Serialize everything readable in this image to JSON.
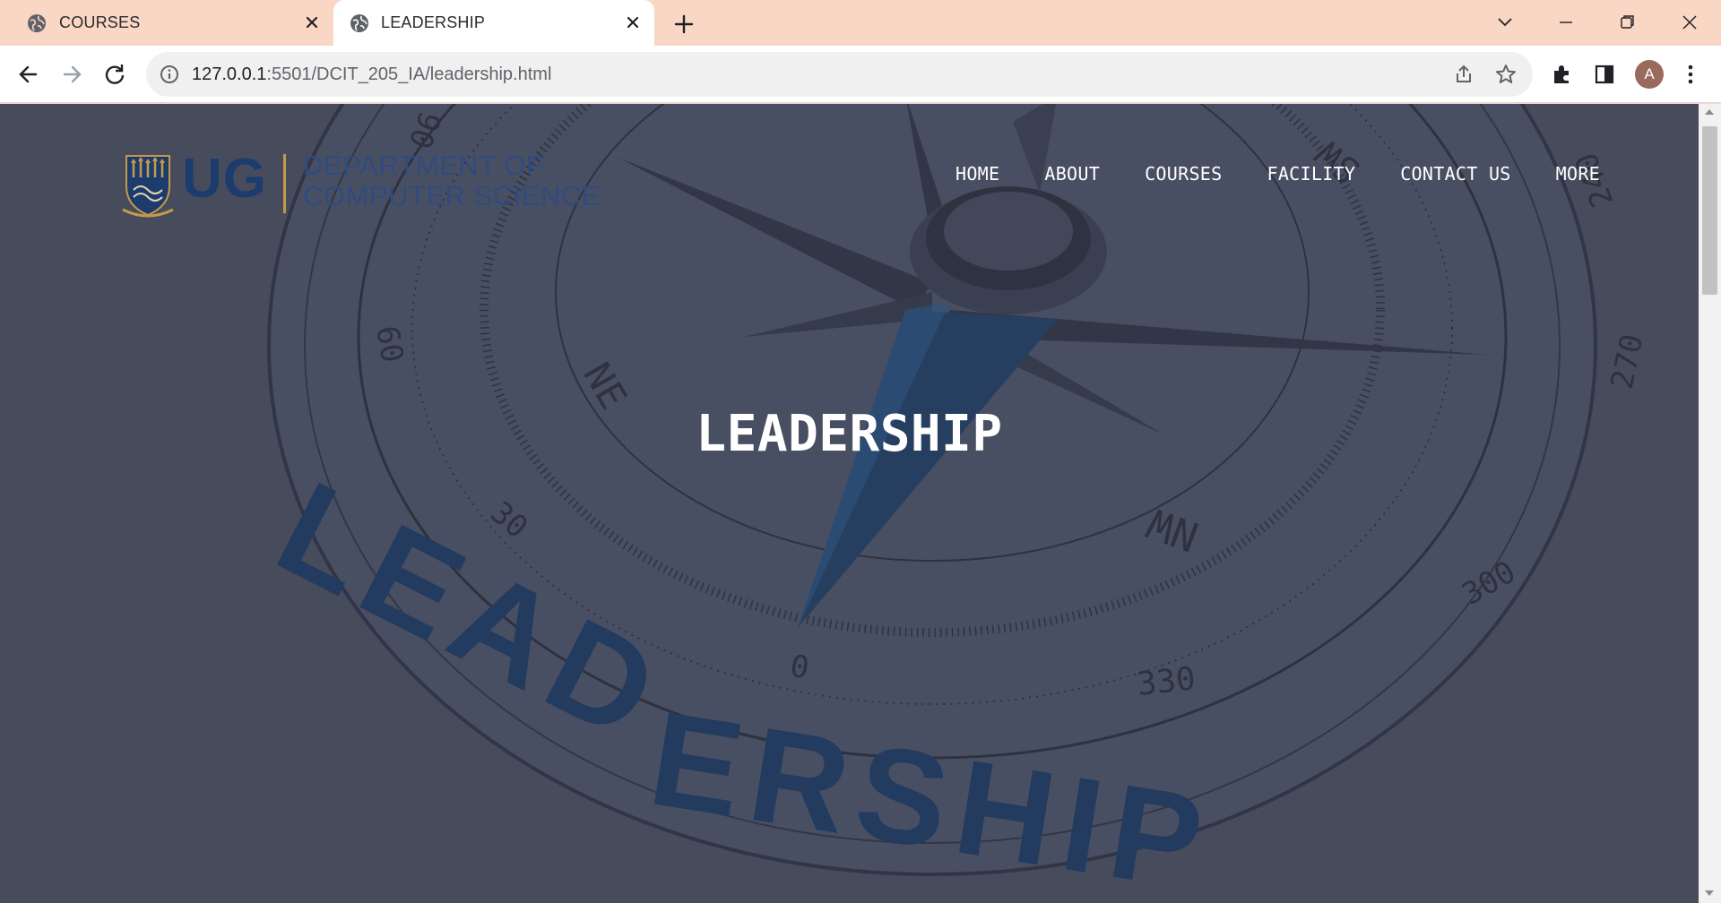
{
  "browser": {
    "tabs": [
      {
        "title": "COURSES",
        "active": false
      },
      {
        "title": "LEADERSHIP",
        "active": true
      }
    ],
    "url_host": "127.0.0.1",
    "url_path": ":5501/DCIT_205_IA/leadership.html",
    "profile_initial": "A",
    "colors": {
      "tabstrip": "#fad6c4",
      "active_tab": "#ffffff",
      "omnibox": "#f0f0f0"
    }
  },
  "site": {
    "logo": {
      "mark": "UG",
      "dept_line_1": "DEPARTMENT OF",
      "dept_line_2": "COMPUTER SCIENCE"
    },
    "nav": [
      "HOME",
      "ABOUT",
      "COURSES",
      "FACILITY",
      "CONTACT US",
      "MORE"
    ],
    "hero": {
      "title": "LEADERSHIP",
      "background_word": "LEADERSHIP",
      "compass_labels": [
        "90",
        "60",
        "30",
        "0",
        "330",
        "300",
        "270",
        "240",
        "NE",
        "NW",
        "SW"
      ]
    },
    "colors": {
      "overlay": "#4a4f5f",
      "brand_blue": "#1d3c6e",
      "nav_text": "#ffffff"
    }
  }
}
